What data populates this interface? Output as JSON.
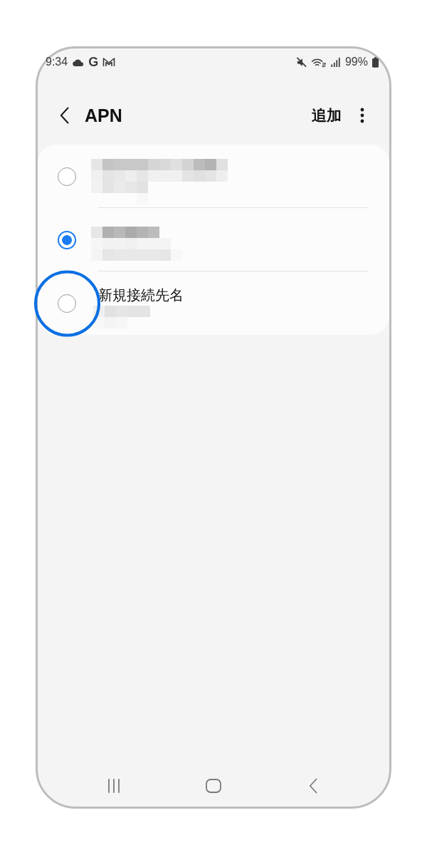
{
  "status_bar": {
    "time": "9:34",
    "notification_letter": "G",
    "battery_percent": "99%"
  },
  "header": {
    "title": "APN",
    "add_action": "追加"
  },
  "apn_list": [
    {
      "selected": false,
      "highlighted": false
    },
    {
      "selected": true,
      "highlighted": false
    },
    {
      "title": "新規接続先名",
      "selected": false,
      "highlighted": true
    }
  ]
}
